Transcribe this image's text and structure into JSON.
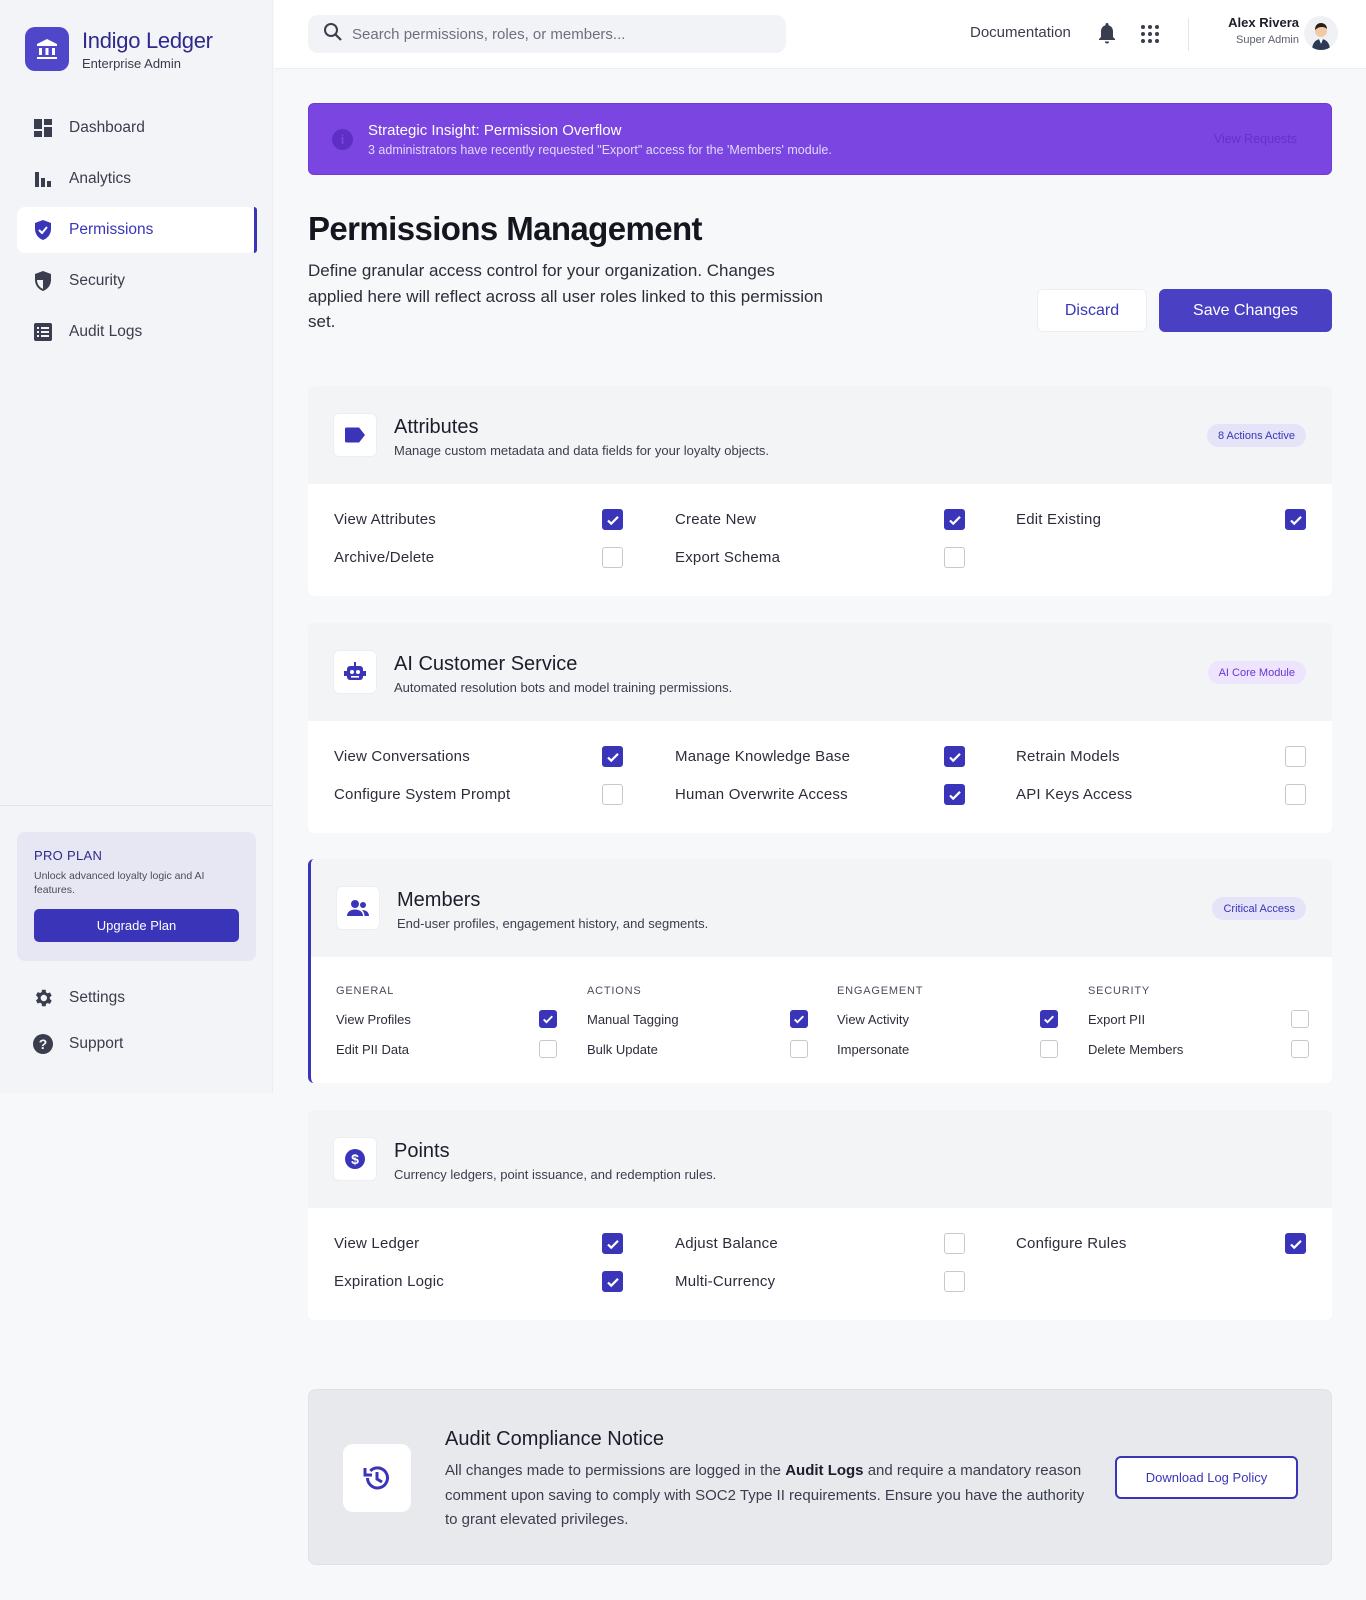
{
  "brand": {
    "name": "Indigo Ledger",
    "subtitle": "Enterprise Admin"
  },
  "sidebar": {
    "items": [
      {
        "label": "Dashboard",
        "icon": "dashboard-icon",
        "active": false
      },
      {
        "label": "Analytics",
        "icon": "bar-chart-icon",
        "active": false
      },
      {
        "label": "Permissions",
        "icon": "shield-check-icon",
        "active": true
      },
      {
        "label": "Security",
        "icon": "shield-icon",
        "active": false
      },
      {
        "label": "Audit Logs",
        "icon": "list-icon",
        "active": false
      }
    ],
    "pro": {
      "title": "PRO PLAN",
      "desc": "Unlock advanced loyalty logic and AI features.",
      "button": "Upgrade Plan"
    },
    "footer": [
      {
        "label": "Settings",
        "icon": "gear-icon"
      },
      {
        "label": "Support",
        "icon": "help-icon"
      }
    ]
  },
  "header": {
    "search_placeholder": "Search permissions, roles, or members...",
    "documentation": "Documentation",
    "user": {
      "name": "Alex Rivera",
      "role": "Super Admin"
    }
  },
  "banner": {
    "title": "Strategic Insight: Permission Overflow",
    "subtitle": "3 administrators have recently requested \"Export\" access for the 'Members' module.",
    "link": "View Requests"
  },
  "page": {
    "title": "Permissions Management",
    "description": "Define granular access control for your organization. Changes applied here will reflect across all user roles linked to this permission set.",
    "discard": "Discard",
    "save": "Save Changes"
  },
  "cards": {
    "attributes": {
      "title": "Attributes",
      "subtitle": "Manage custom metadata and data fields for your loyalty objects.",
      "badge": "8 Actions Active",
      "perms": [
        {
          "label": "View Attributes",
          "checked": true
        },
        {
          "label": "Create New",
          "checked": true
        },
        {
          "label": "Edit Existing",
          "checked": true
        },
        {
          "label": "Archive/Delete",
          "checked": false
        },
        {
          "label": "Export Schema",
          "checked": false
        }
      ]
    },
    "ai": {
      "title": "AI Customer Service",
      "subtitle": "Automated resolution bots and model training permissions.",
      "badge": "AI Core Module",
      "perms": [
        {
          "label": "View Conversations",
          "checked": true
        },
        {
          "label": "Manage Knowledge Base",
          "checked": true
        },
        {
          "label": "Retrain Models",
          "checked": false
        },
        {
          "label": "Configure System Prompt",
          "checked": false
        },
        {
          "label": "Human Overwrite Access",
          "checked": true
        },
        {
          "label": "API Keys Access",
          "checked": false
        }
      ]
    },
    "members": {
      "title": "Members",
      "subtitle": "End-user profiles, engagement history, and segments.",
      "badge": "Critical Access",
      "groups": [
        {
          "title": "GENERAL",
          "perms": [
            {
              "label": "View Profiles",
              "checked": true
            },
            {
              "label": "Edit PII Data",
              "checked": false
            }
          ]
        },
        {
          "title": "ACTIONS",
          "perms": [
            {
              "label": "Manual Tagging",
              "checked": true
            },
            {
              "label": "Bulk Update",
              "checked": false
            }
          ]
        },
        {
          "title": "ENGAGEMENT",
          "perms": [
            {
              "label": "View Activity",
              "checked": true
            },
            {
              "label": "Impersonate",
              "checked": false
            }
          ]
        },
        {
          "title": "SECURITY",
          "perms": [
            {
              "label": "Export PII",
              "checked": false
            },
            {
              "label": "Delete Members",
              "checked": false
            }
          ]
        }
      ]
    },
    "points": {
      "title": "Points",
      "subtitle": "Currency ledgers, point issuance, and redemption rules.",
      "perms": [
        {
          "label": "View Ledger",
          "checked": true
        },
        {
          "label": "Adjust Balance",
          "checked": false
        },
        {
          "label": "Configure Rules",
          "checked": true
        },
        {
          "label": "Expiration Logic",
          "checked": true
        },
        {
          "label": "Multi-Currency",
          "checked": false
        }
      ]
    }
  },
  "audit": {
    "title": "Audit Compliance Notice",
    "text_before": "All changes made to permissions are logged in the ",
    "text_bold": "Audit Logs",
    "text_after": " and require a mandatory reason comment upon saving to comply with SOC2 Type II requirements. Ensure you have the authority to grant elevated privileges.",
    "button": "Download Log Policy"
  },
  "colors": {
    "brand": "#3a35b8",
    "banner": "#7a45e0",
    "checked": "#3a35b8"
  }
}
